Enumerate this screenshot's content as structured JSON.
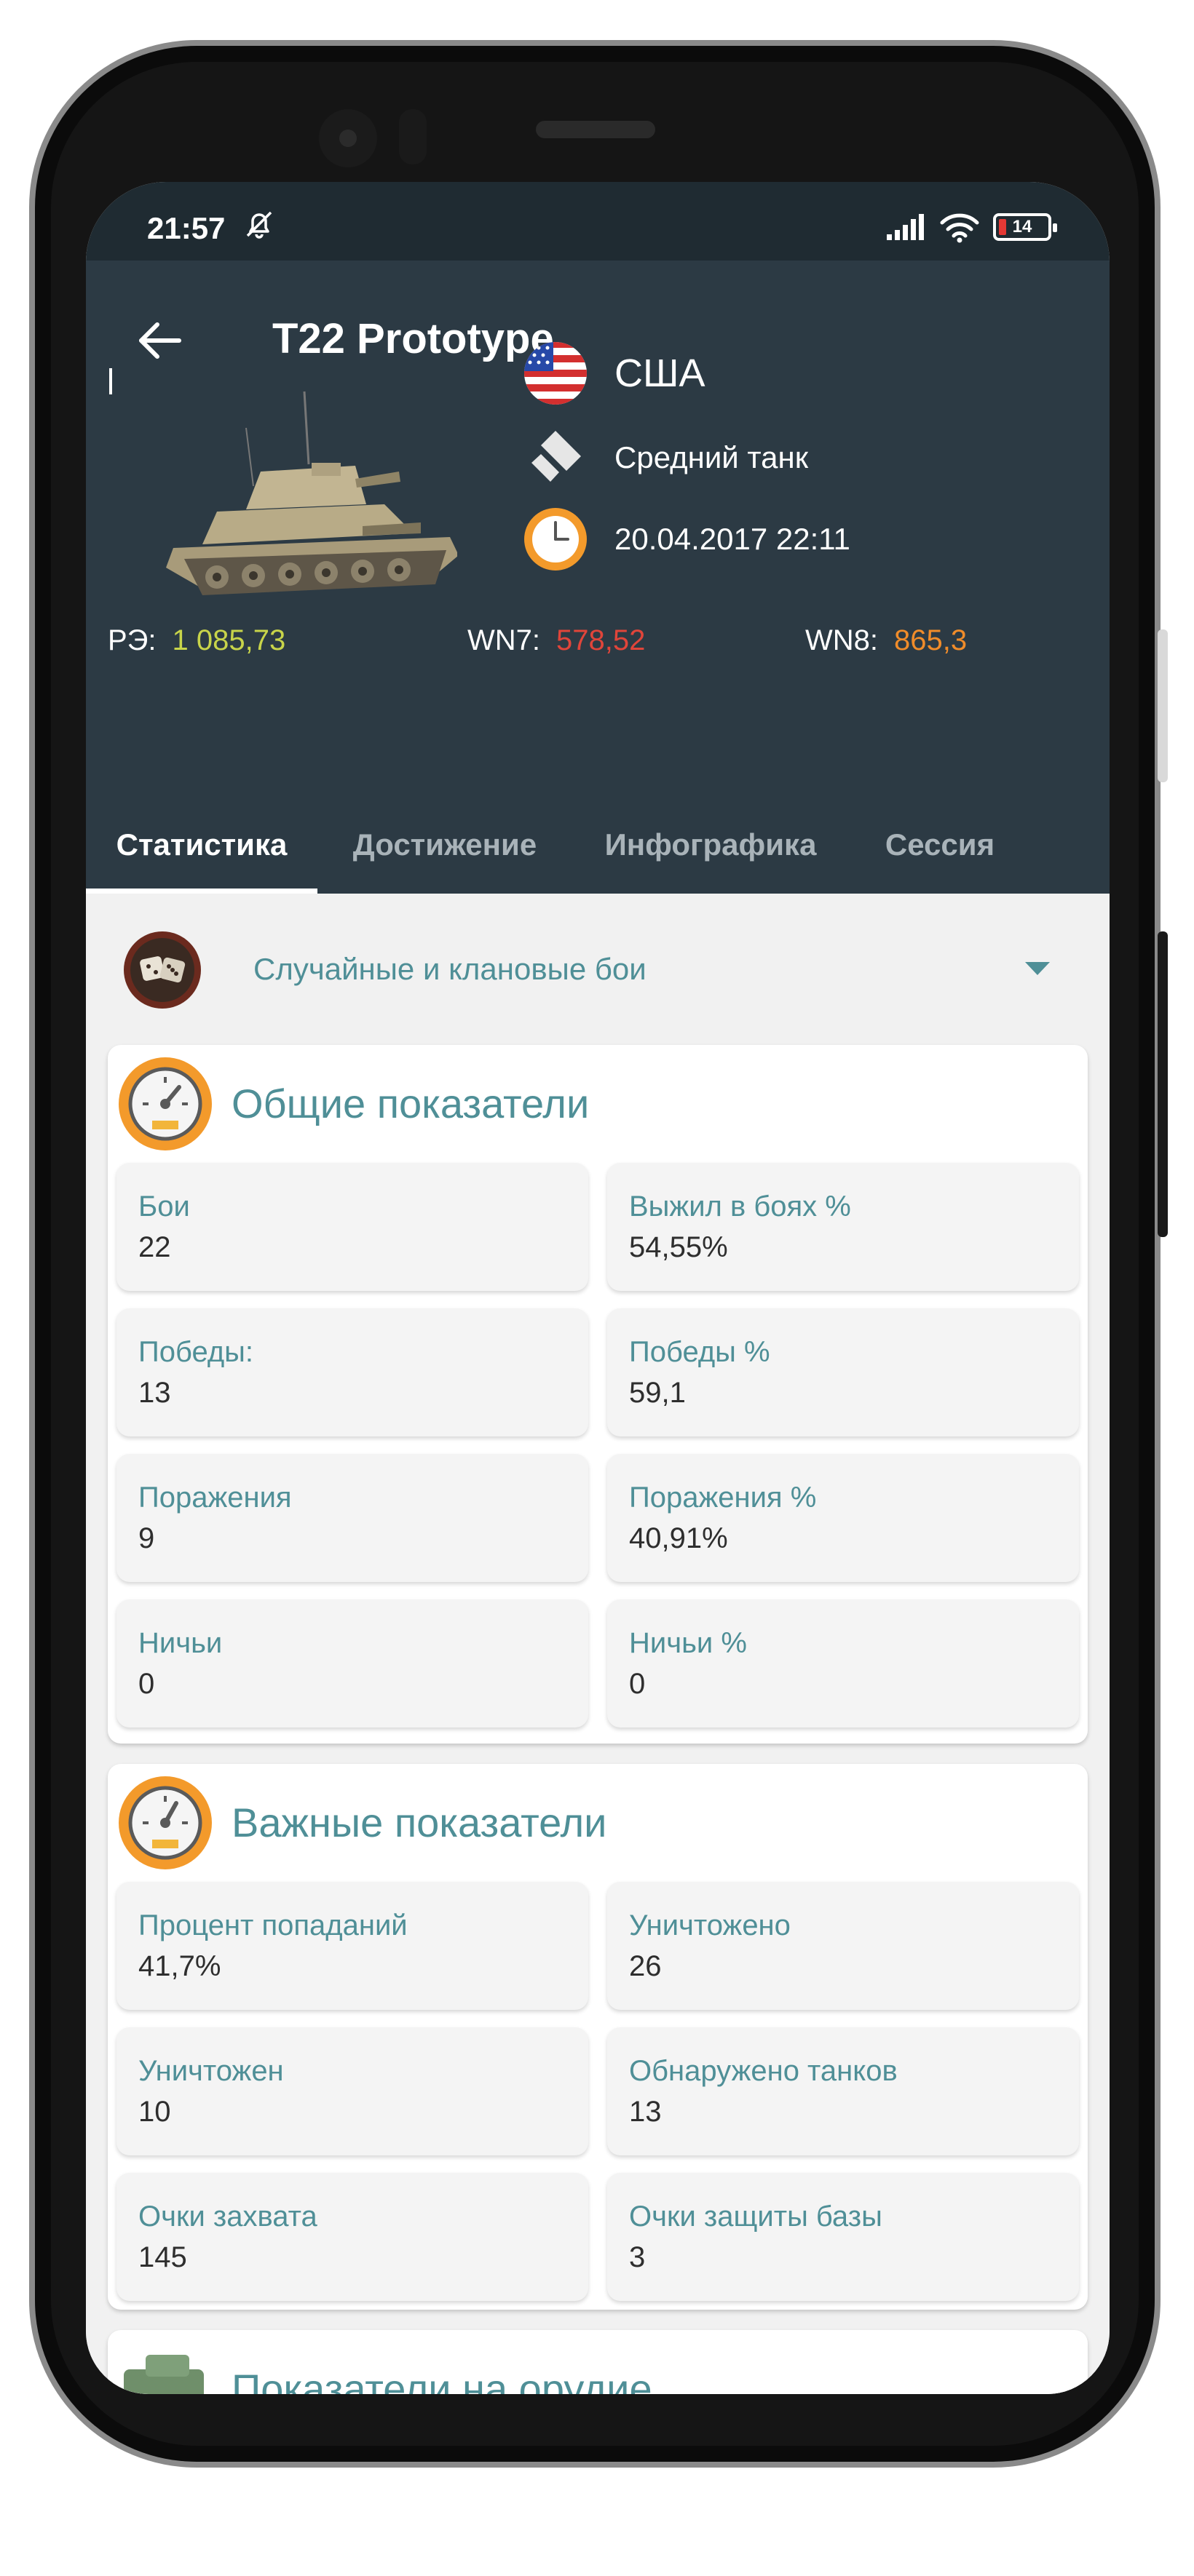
{
  "status_bar": {
    "time": "21:57",
    "battery": "14"
  },
  "header": {
    "title": "T22 Prototype",
    "nation": "США",
    "tank_class": "Средний танк",
    "date": "20.04.2017 22:11"
  },
  "ratings": [
    {
      "label": "РЭ:",
      "value": "1 085,73",
      "color": "#c8d44a"
    },
    {
      "label": "WN7:",
      "value": "578,52",
      "color": "#e0453a"
    },
    {
      "label": "WN8:",
      "value": "865,3",
      "color": "#f08c2a"
    }
  ],
  "tabs": [
    "Статистика",
    "Достижение",
    "Инфографика",
    "Сессия"
  ],
  "battle_type": "Случайные и клановые бои",
  "sections": [
    {
      "title": "Общие показатели",
      "stats": [
        {
          "label": "Бои",
          "value": "22"
        },
        {
          "label": "Выжил в боях %",
          "value": "54,55%"
        },
        {
          "label": "Победы:",
          "value": "13"
        },
        {
          "label": "Победы %",
          "value": "59,1"
        },
        {
          "label": "Поражения",
          "value": "9"
        },
        {
          "label": "Поражения %",
          "value": "40,91%"
        },
        {
          "label": "Ничьи",
          "value": "0"
        },
        {
          "label": "Ничьи %",
          "value": "0"
        }
      ]
    },
    {
      "title": "Важные показатели",
      "stats": [
        {
          "label": "Процент попаданий",
          "value": "41,7%"
        },
        {
          "label": "Уничтожено",
          "value": "26"
        },
        {
          "label": "Уничтожен",
          "value": "10"
        },
        {
          "label": "Обнаружено танков",
          "value": "13"
        },
        {
          "label": "Очки захвата",
          "value": "145"
        },
        {
          "label": "Очки защиты базы",
          "value": "3"
        }
      ]
    },
    {
      "title": "Показатели на орудие"
    }
  ],
  "colors": {
    "accent": "#4f8f97",
    "header_bg": "#2c3a44",
    "status_bg": "#1f2b32"
  }
}
